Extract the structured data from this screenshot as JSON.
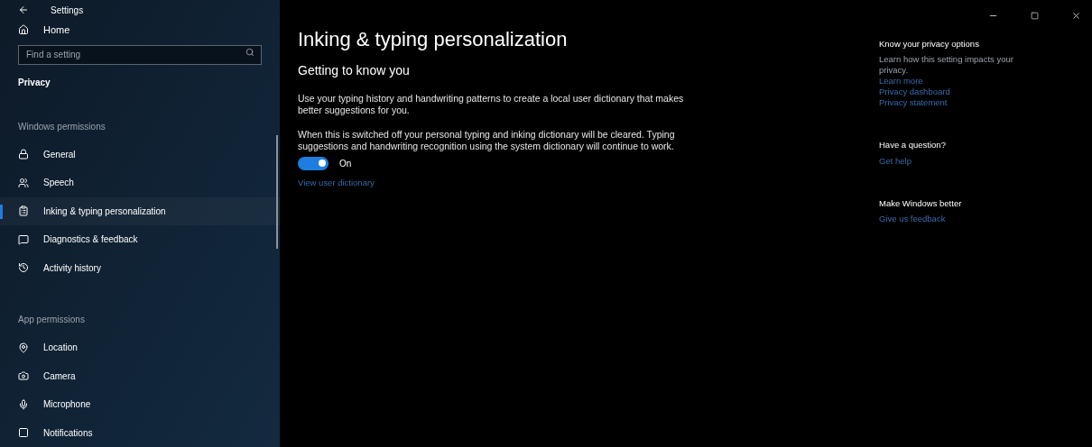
{
  "window": {
    "title": "Settings"
  },
  "sidebar": {
    "home": "Home",
    "search": {
      "placeholder": "Find a setting"
    },
    "section": "Privacy",
    "groups": [
      {
        "heading": "Windows permissions",
        "items": [
          {
            "label": "General",
            "selected": false
          },
          {
            "label": "Speech",
            "selected": false
          },
          {
            "label": "Inking & typing personalization",
            "selected": true
          },
          {
            "label": "Diagnostics & feedback",
            "selected": false
          },
          {
            "label": "Activity history",
            "selected": false
          }
        ]
      },
      {
        "heading": "App permissions",
        "items": [
          {
            "label": "Location",
            "selected": false
          },
          {
            "label": "Camera",
            "selected": false
          },
          {
            "label": "Microphone",
            "selected": false
          },
          {
            "label": "Notifications",
            "selected": false
          }
        ]
      }
    ]
  },
  "main": {
    "title": "Inking & typing personalization",
    "subtitle": "Getting to know you",
    "paragraphs": [
      "Use your typing history and handwriting patterns to create a local user dictionary that makes better suggestions for you.",
      "When this is switched off your personal typing and inking dictionary will be cleared. Typing suggestions and handwriting recognition using the system dictionary will continue to work."
    ],
    "toggle": {
      "on": true,
      "label": "On"
    },
    "link": "View user dictionary"
  },
  "aside": [
    {
      "heading": "Know your privacy options",
      "text": "Learn how this setting impacts your privacy.",
      "links": [
        "Learn more",
        "Privacy dashboard",
        "Privacy statement"
      ]
    },
    {
      "heading": "Have a question?",
      "links": [
        "Get help"
      ]
    },
    {
      "heading": "Make Windows better",
      "links": [
        "Give us feedback"
      ]
    }
  ]
}
